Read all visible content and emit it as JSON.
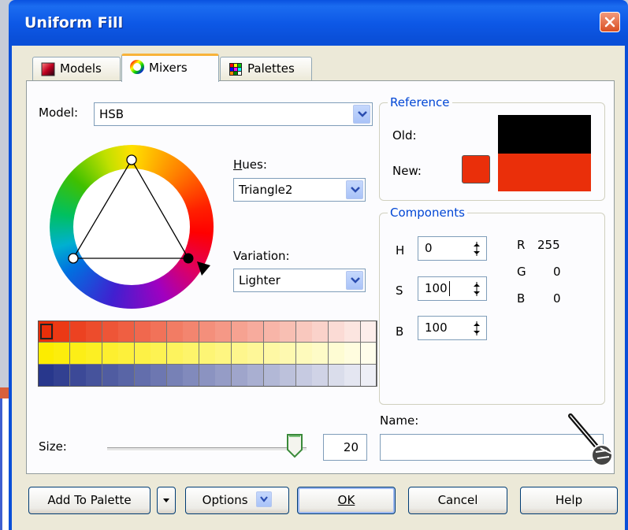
{
  "window": {
    "title": "Uniform Fill"
  },
  "tabs": [
    {
      "label": "Models"
    },
    {
      "label": "Mixers"
    },
    {
      "label": "Palettes"
    }
  ],
  "model": {
    "label": "Model:",
    "value": "HSB"
  },
  "hues": {
    "label": "Hues:",
    "value": "Triangle2"
  },
  "variation": {
    "label": "Variation:",
    "value": "Lighter"
  },
  "reference": {
    "legend": "Reference",
    "old_label": "Old:",
    "new_label": "New:",
    "old_color": "#000000",
    "new_color": "#ea2f0a"
  },
  "components": {
    "legend": "Components",
    "h": {
      "label": "H",
      "value": "0"
    },
    "s": {
      "label": "S",
      "value": "100"
    },
    "b": {
      "label": "B",
      "value": "100"
    },
    "rgb": [
      {
        "label": "R",
        "value": "255"
      },
      {
        "label": "G",
        "value": "0"
      },
      {
        "label": "B",
        "value": "0"
      }
    ]
  },
  "size": {
    "label": "Size:",
    "value": "20"
  },
  "name": {
    "label": "Name:",
    "value": ""
  },
  "buttons": {
    "add_to_palette": "Add To Palette",
    "options": "Options",
    "ok": "OK",
    "cancel": "Cancel",
    "help": "Help"
  },
  "colors": {
    "accent": "#0a52e0",
    "tab_highlight": "#f8b33a",
    "group_legend": "#0046d5"
  },
  "icons": [
    "close-icon",
    "models-icon",
    "mixers-icon",
    "palettes-icon",
    "chevron-down-icon",
    "spin-icon",
    "slider-thumb-icon",
    "hand-cursor-icon"
  ]
}
